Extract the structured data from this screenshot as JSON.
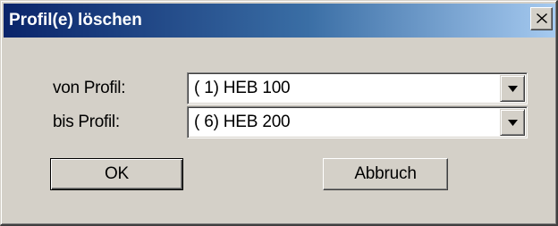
{
  "window": {
    "title": "Profil(e) löschen",
    "close_icon": "close-icon"
  },
  "form": {
    "from_label": "von Profil:",
    "from_value": "( 1) HEB 100",
    "to_label": "bis Profil:",
    "to_value": "( 6) HEB 200",
    "dropdown_icon": "chevron-down-icon"
  },
  "buttons": {
    "ok_label": "OK",
    "cancel_label": "Abbruch"
  },
  "colors": {
    "titlebar_start": "#0a246a",
    "titlebar_end": "#a6caf0",
    "face": "#d4d0c8"
  }
}
